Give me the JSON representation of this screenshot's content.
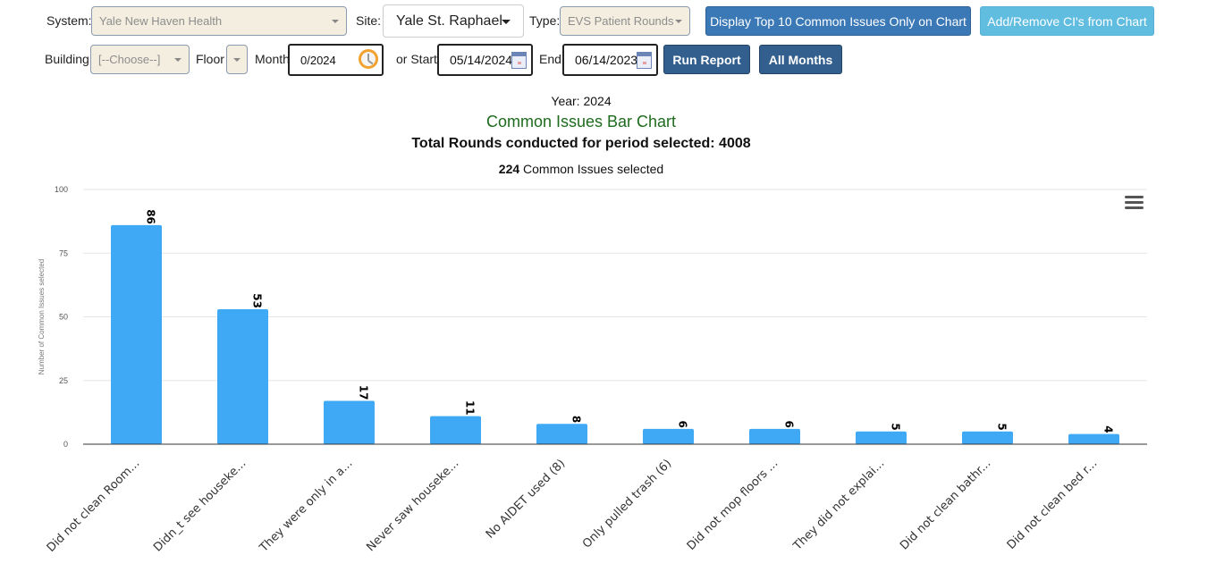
{
  "filters": {
    "system_label": "System:",
    "system_value": "Yale New Haven Health",
    "site_label": "Site:",
    "site_value": "Yale St. Raphael",
    "type_label": "Type:",
    "type_value": "EVS Patient Rounds",
    "building_label": "Building",
    "building_value": "[--Choose--]",
    "floor_label": "Floor",
    "floor_value": "",
    "month_label": "Month",
    "month_value": "0/2024",
    "start_label": "or Start",
    "start_value": "05/14/2024",
    "end_label": "End",
    "end_value": "06/14/2023"
  },
  "buttons": {
    "top10": "Display Top 10 Common Issues Only on Chart",
    "add_remove": "Add/Remove CI's from Chart",
    "run_report": "Run Report",
    "all_months": "All Months"
  },
  "header": {
    "year": "Year: 2024",
    "total_rounds": "Total Rounds conducted for period selected: 4008",
    "issues_count": "224",
    "issues_text": " Common Issues selected"
  },
  "colors": {
    "bar": "#3fa9f5",
    "title": "#1e6b1e",
    "primary_button": "#3a78b6",
    "info_button": "#60bde0",
    "dark_button": "#325f8e"
  },
  "chart_data": {
    "type": "bar",
    "title": "Common Issues Bar Chart",
    "xlabel": "",
    "ylabel": "Number of Common Issues selected",
    "ylim": [
      0,
      100
    ],
    "yticks": [
      0,
      25,
      50,
      75,
      100
    ],
    "grid": true,
    "legend": "none",
    "categories": [
      "Did not clean Room...",
      "Didn_t see houseke...",
      "They were only in a...",
      "Never saw houseke...",
      "No AIDET used (8)",
      "Only pulled trash (6)",
      "Did not mop floors ...",
      "They did not explai...",
      "Did not clean bathr...",
      "Did not clean bed r..."
    ],
    "values": [
      86,
      53,
      17,
      11,
      8,
      6,
      6,
      5,
      5,
      4
    ]
  }
}
